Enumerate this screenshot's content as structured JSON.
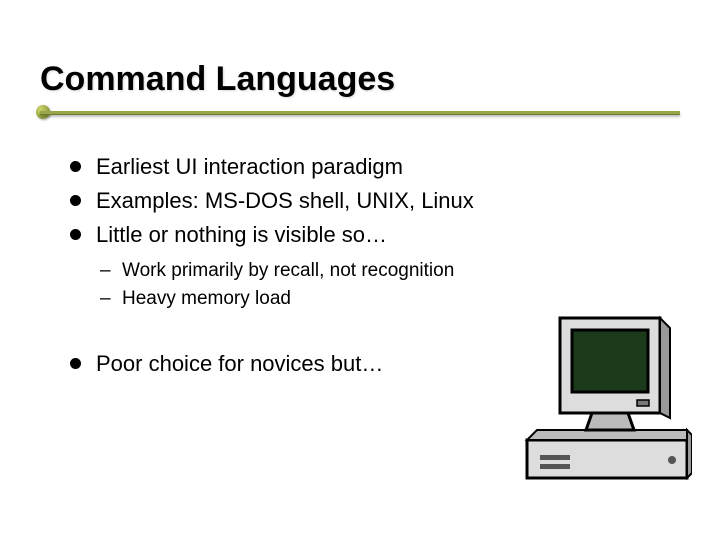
{
  "title": "Command Languages",
  "bullets": {
    "b1": "Earliest UI interaction paradigm",
    "b2": "Examples: MS-DOS shell, UNIX, Linux",
    "b3": "Little or nothing is visible so…",
    "b4": "Poor choice for novices but…"
  },
  "sub_bullets": {
    "s1": "Work primarily by recall, not recognition",
    "s2": "Heavy memory load"
  }
}
